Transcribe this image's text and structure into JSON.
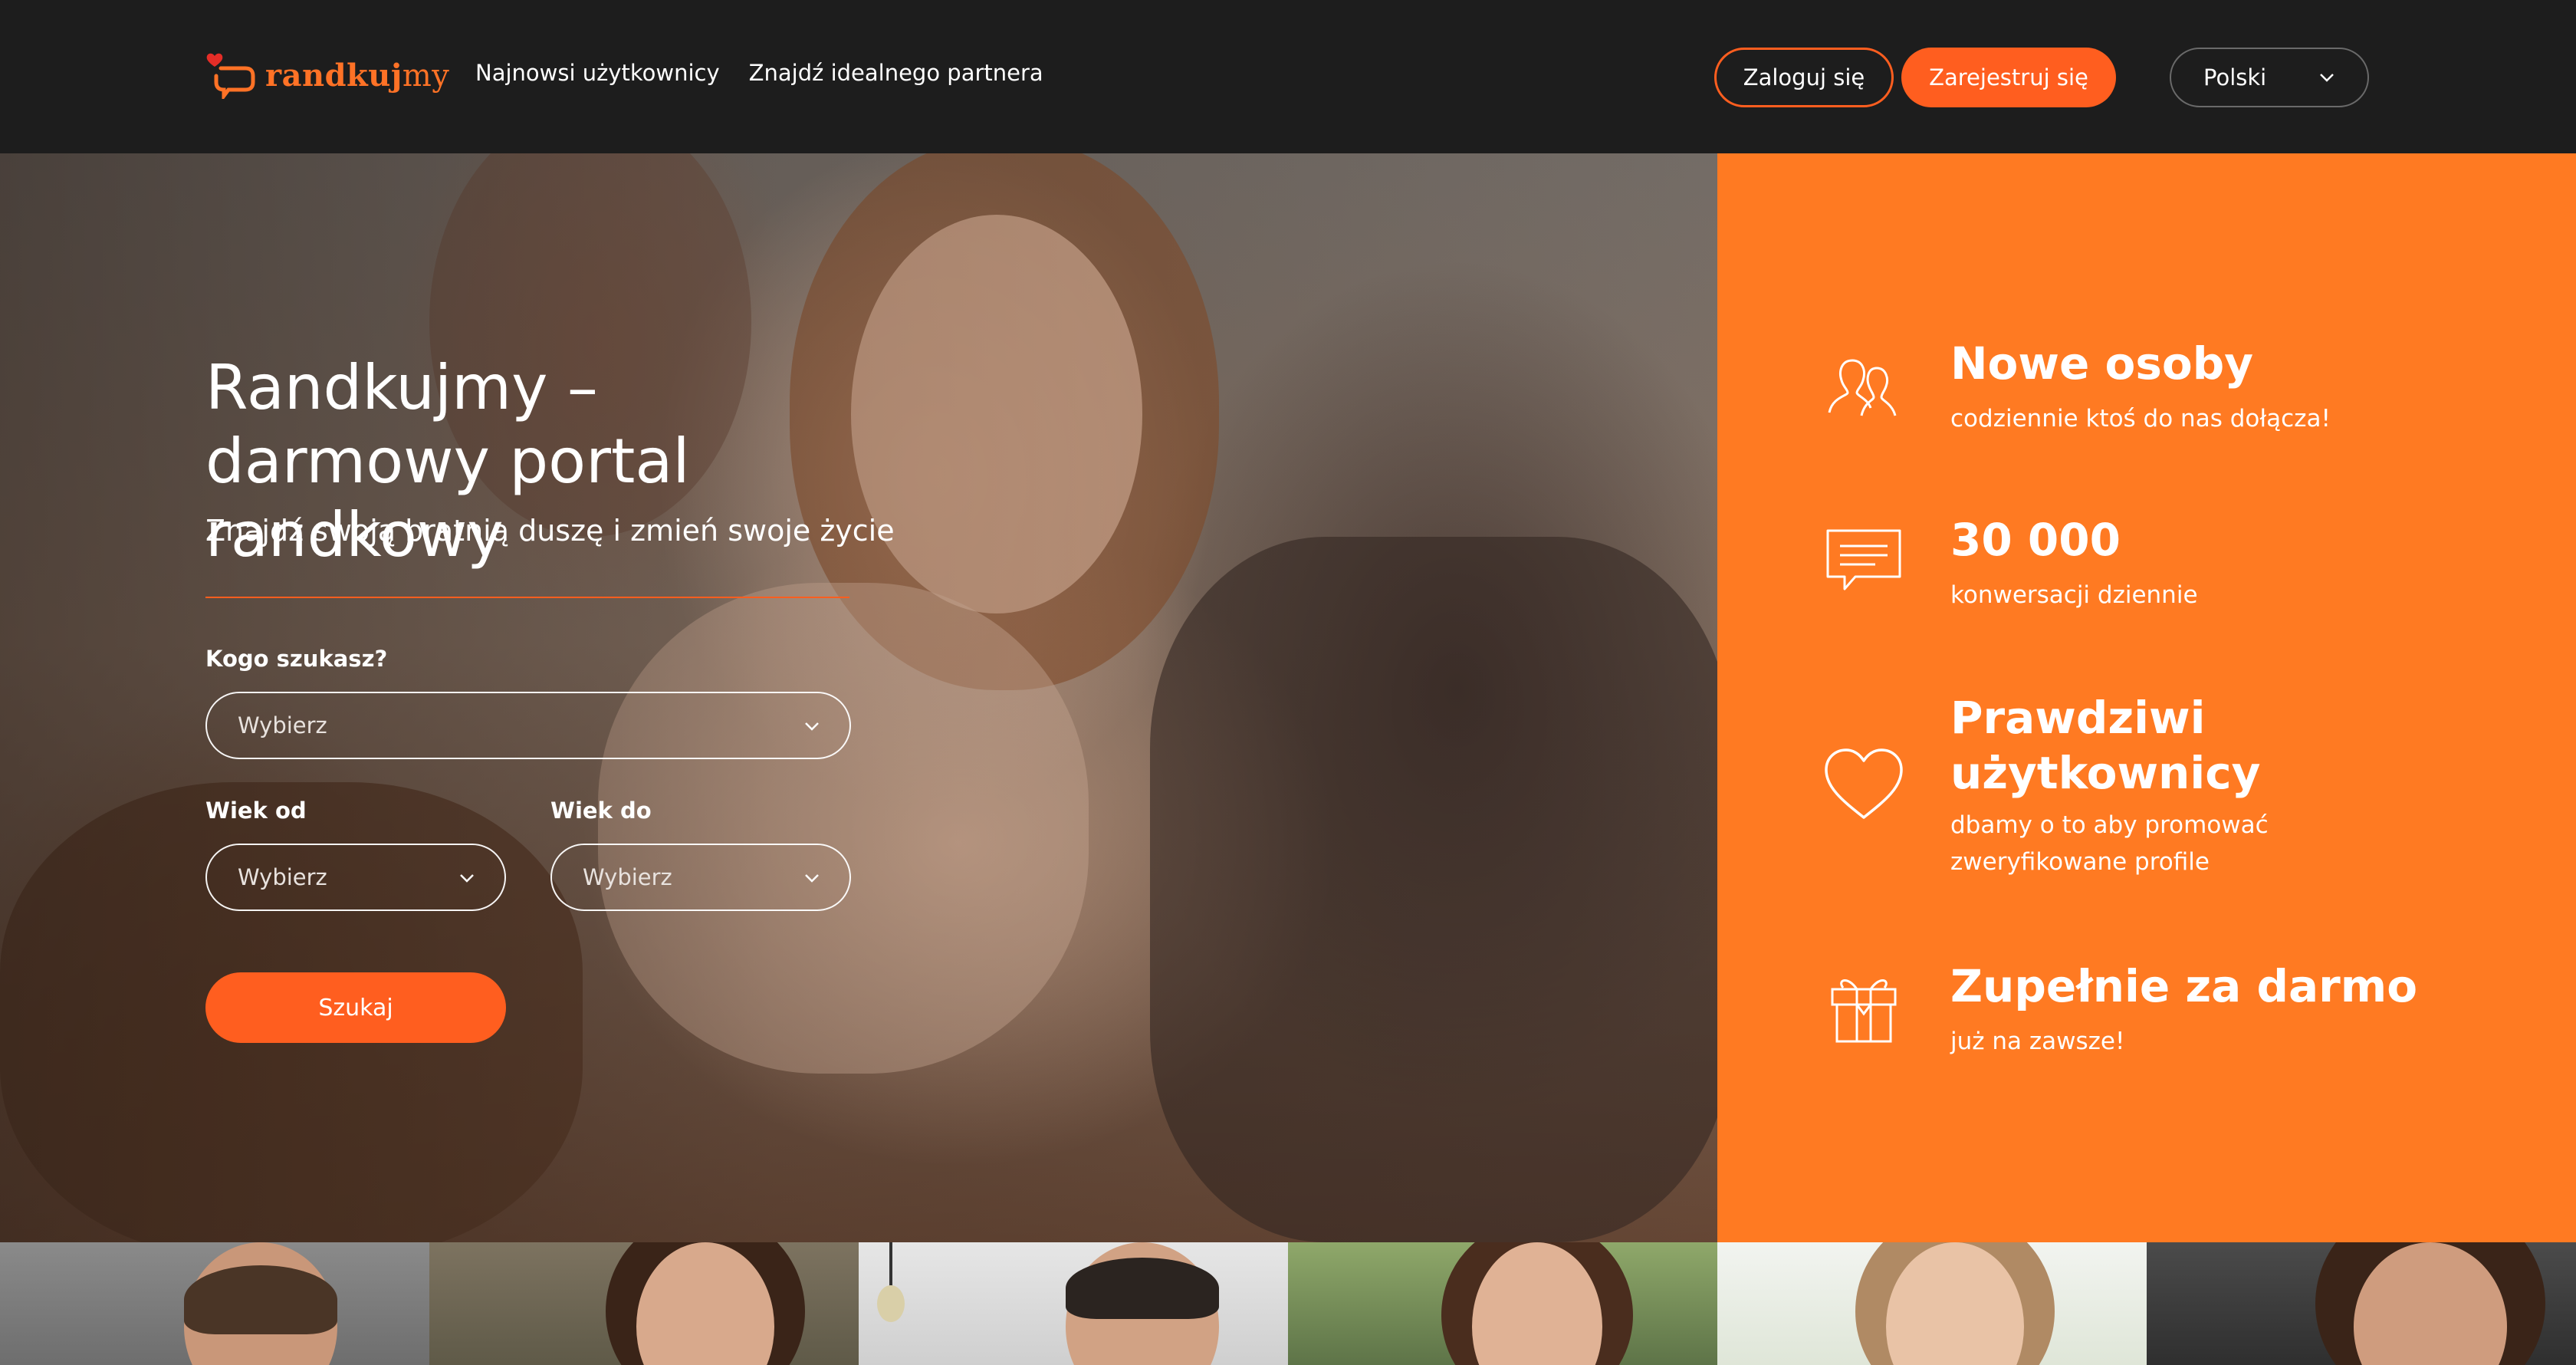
{
  "header": {
    "logo": {
      "bold": "randkuj",
      "light": "my"
    },
    "nav": [
      "Najnowsi użytkownicy",
      "Znajdź idealnego partnera"
    ],
    "login_label": "Zaloguj się",
    "register_label": "Zarejestruj się",
    "language": "Polski"
  },
  "hero": {
    "title": "Randkujmy – darmowy portal randkowy",
    "subtitle": "Znajdź swoją bratnią duszę i zmień swoje życie",
    "who_label": "Kogo szukasz?",
    "who_value": "Wybierz",
    "age_from_label": "Wiek od",
    "age_from_value": "Wybierz",
    "age_to_label": "Wiek do",
    "age_to_value": "Wybierz",
    "search_label": "Szukaj"
  },
  "features": [
    {
      "icon": "users-icon",
      "title": "Nowe osoby",
      "desc": "codziennie ktoś do nas dołącza!"
    },
    {
      "icon": "chat-icon",
      "title": "30 000",
      "desc": "konwersacji dziennie"
    },
    {
      "icon": "heart-icon",
      "title": "Prawdziwi użytkownicy",
      "desc": "dbamy o to aby promować zweryfikowane profile"
    },
    {
      "icon": "gift-icon",
      "title": "Zupełnie za darmo",
      "desc": "już na zawsze!"
    }
  ],
  "colors": {
    "accent": "#ff5e1f",
    "panel": "#ff7a22",
    "header": "#1d1d1d"
  }
}
